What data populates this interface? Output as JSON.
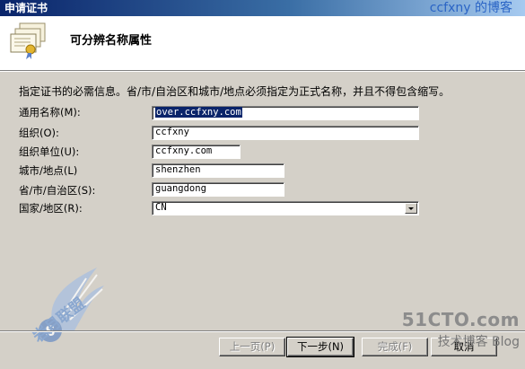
{
  "window": {
    "title": "申请证书",
    "watermark_top": "ccfxny 的博客"
  },
  "header": {
    "title": "可分辨名称属性",
    "icon": "certificate-icon"
  },
  "instruction": "指定证书的必需信息。省/市/自治区和城市/地点必须指定为正式名称，并且不得包含缩写。",
  "fields": {
    "common_name": {
      "label": "通用名称(M):",
      "value": "over.ccfxny.com"
    },
    "organization": {
      "label": "组织(O):",
      "value": "ccfxny"
    },
    "org_unit": {
      "label": "组织单位(U):",
      "value": "ccfxny.com"
    },
    "city": {
      "label": "城市/地点(L)",
      "value": "shenzhen"
    },
    "state": {
      "label": "省/市/自治区(S):",
      "value": "guangdong"
    },
    "country": {
      "label": "国家/地区(R):",
      "value": "CN"
    }
  },
  "buttons": {
    "back": "上一页(P)",
    "next": "下一步(N)",
    "finish": "完成(F)",
    "cancel": "取消"
  },
  "watermarks": {
    "site": "51CTO.com",
    "blog": "技术博客  Blog",
    "logo_text": "岩月联盟",
    "logo_url": "5yue.com"
  }
}
